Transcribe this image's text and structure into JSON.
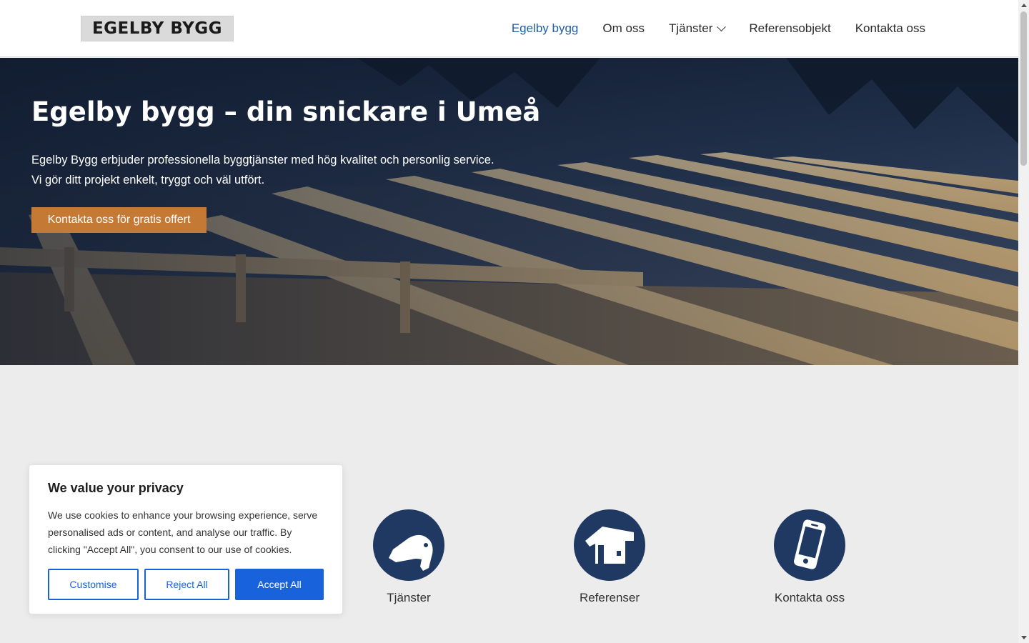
{
  "header": {
    "logo_text": "EGELBY BYGG",
    "nav": [
      {
        "label": "Egelby bygg",
        "active": true
      },
      {
        "label": "Om oss"
      },
      {
        "label": "Tjänster",
        "has_dropdown": true
      },
      {
        "label": "Referensobjekt"
      },
      {
        "label": "Kontakta oss"
      }
    ]
  },
  "hero": {
    "title": "Egelby bygg – din snickare i Umeå",
    "text_line1": "Egelby Bygg erbjuder professionella byggtjänster med hög kvalitet och personlig service.",
    "text_line2": "Vi gör ditt projekt enkelt, tryggt och väl utfört.",
    "cta_label": "Kontakta oss för gratis offert"
  },
  "features": [
    {
      "label": "Tjänster",
      "icon": "drill-icon"
    },
    {
      "label": "Referenser",
      "icon": "house-icon"
    },
    {
      "label": "Kontakta oss",
      "icon": "phone-icon"
    }
  ],
  "cookie": {
    "title": "We value your privacy",
    "body": "We use cookies to enhance your browsing experience, serve personalised ads or content, and analyse our traffic. By clicking \"Accept All\", you consent to our use of cookies.",
    "customise_label": "Customise",
    "reject_label": "Reject All",
    "accept_label": "Accept All"
  },
  "colors": {
    "accent_nav": "#1f5ea8",
    "cta_orange": "#c47a35",
    "icon_navy": "#1f3962",
    "cookie_blue": "#1863dc",
    "section_bg": "#ececec"
  }
}
